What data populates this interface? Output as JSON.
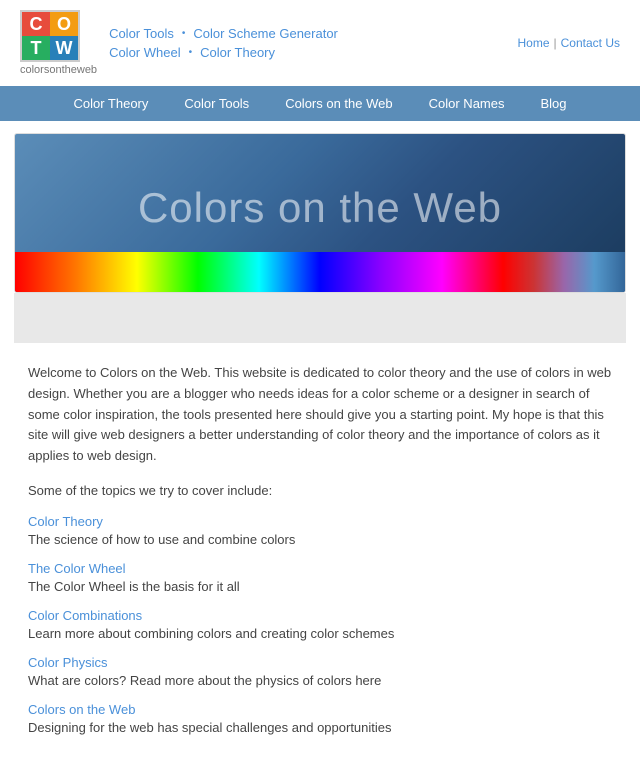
{
  "header": {
    "logo_letters": [
      "C",
      "O",
      "T",
      "W"
    ],
    "logo_subtitle": "colorsontheweb",
    "link_row1": [
      {
        "label": "Color Tools",
        "href": "#"
      },
      {
        "bullet": "•"
      },
      {
        "label": "Color Scheme Generator",
        "href": "#"
      }
    ],
    "link_row2": [
      {
        "label": "Color Wheel",
        "href": "#"
      },
      {
        "bullet": "•"
      },
      {
        "label": "Color Theory",
        "href": "#"
      }
    ],
    "top_right": {
      "home": "Home",
      "sep": "|",
      "contact": "Contact Us"
    }
  },
  "nav": {
    "items": [
      "Color Theory",
      "Color Tools",
      "Colors on the Web",
      "Color Names",
      "Blog"
    ]
  },
  "hero": {
    "title": "Colors on the Web"
  },
  "content": {
    "intro": "Welcome to Colors on the Web. This website is dedicated to color theory and the use of colors in web design. Whether you are a blogger who needs ideas for a color scheme or a designer in search of some color inspiration, the tools presented here should give you a starting point. My hope is that this site will give web designers a better understanding of color theory and the importance of colors as it applies to web design.",
    "topics_intro": "Some of the topics we try to cover include:",
    "topics": [
      {
        "link": "Color Theory",
        "desc": "The science of how to use and combine colors"
      },
      {
        "link": "The Color Wheel",
        "desc": "The Color Wheel is the basis for it all"
      },
      {
        "link": "Color Combinations",
        "desc": "Learn more about combining colors and creating color schemes"
      },
      {
        "link": "Color Physics",
        "desc": "What are colors? Read more about the physics of colors here"
      },
      {
        "link": "Colors on the Web",
        "desc": "Designing for the web has special challenges and opportunities"
      }
    ]
  }
}
